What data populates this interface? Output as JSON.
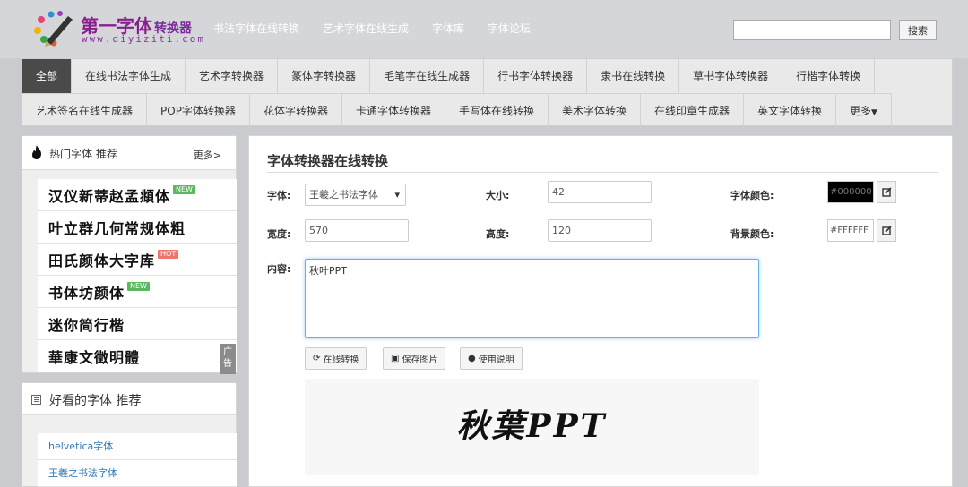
{
  "header": {
    "logo_title": "第一字体",
    "logo_title_suffix": "转换器",
    "logo_url": "www.diyiziti.com",
    "nav": [
      "书法字体在线转换",
      "艺术字体在线生成",
      "字体库",
      "字体论坛"
    ],
    "search_placeholder": "",
    "search_button": "搜索"
  },
  "categories": {
    "row1": [
      "全部",
      "在线书法字体生成",
      "艺术字转换器",
      "篆体字转换器",
      "毛笔字在线生成器",
      "行书字体转换器",
      "隶书在线转换",
      "草书字体转换器",
      "行楷字体转换"
    ],
    "row2": [
      "艺术签名在线生成器",
      "POP字体转换器",
      "花体字转换器",
      "卡通字体转换器",
      "手写体在线转换",
      "美术字体转换",
      "在线印章生成器",
      "英文字体转换",
      "更多"
    ]
  },
  "hot_panel": {
    "title": "热门字体  推荐",
    "more": "更多>",
    "items": [
      {
        "label": "汉仪新蒂赵孟頫体",
        "badge": "NEW"
      },
      {
        "label": "叶立群几何常规体粗",
        "badge": ""
      },
      {
        "label": "田氏颜体大字库",
        "badge": "HOT"
      },
      {
        "label": "书体坊颜体",
        "badge": "NEW"
      },
      {
        "label": "迷你简行楷",
        "badge": ""
      },
      {
        "label": "華康文徵明體",
        "badge": ""
      }
    ],
    "ad_label": "广告"
  },
  "good_panel": {
    "title": "好看的字体 推荐",
    "items": [
      "helvetica字体",
      "王羲之书法字体"
    ]
  },
  "converter": {
    "title": "字体转换器在线转换",
    "font_label": "字体:",
    "font_value": "王羲之书法字体",
    "size_label": "大小:",
    "size_value": "42",
    "font_color_label": "字体颜色:",
    "font_color_value": "#000000",
    "width_label": "宽度:",
    "width_value": "570",
    "height_label": "高度:",
    "height_value": "120",
    "bg_color_label": "背景颜色:",
    "bg_color_value": "#FFFFFF",
    "content_label": "内容:",
    "content_value": "秋叶PPT",
    "convert_button": "在线转换",
    "save_button": "保存图片",
    "help_button": "使用说明",
    "preview_text": "秋葉PPT"
  },
  "colors": {
    "header_bg": "#d4d6da",
    "brand": "#8b1e8f",
    "active_tab": "#4a4a4a",
    "focus": "#66afe9",
    "link": "#337ab7"
  }
}
